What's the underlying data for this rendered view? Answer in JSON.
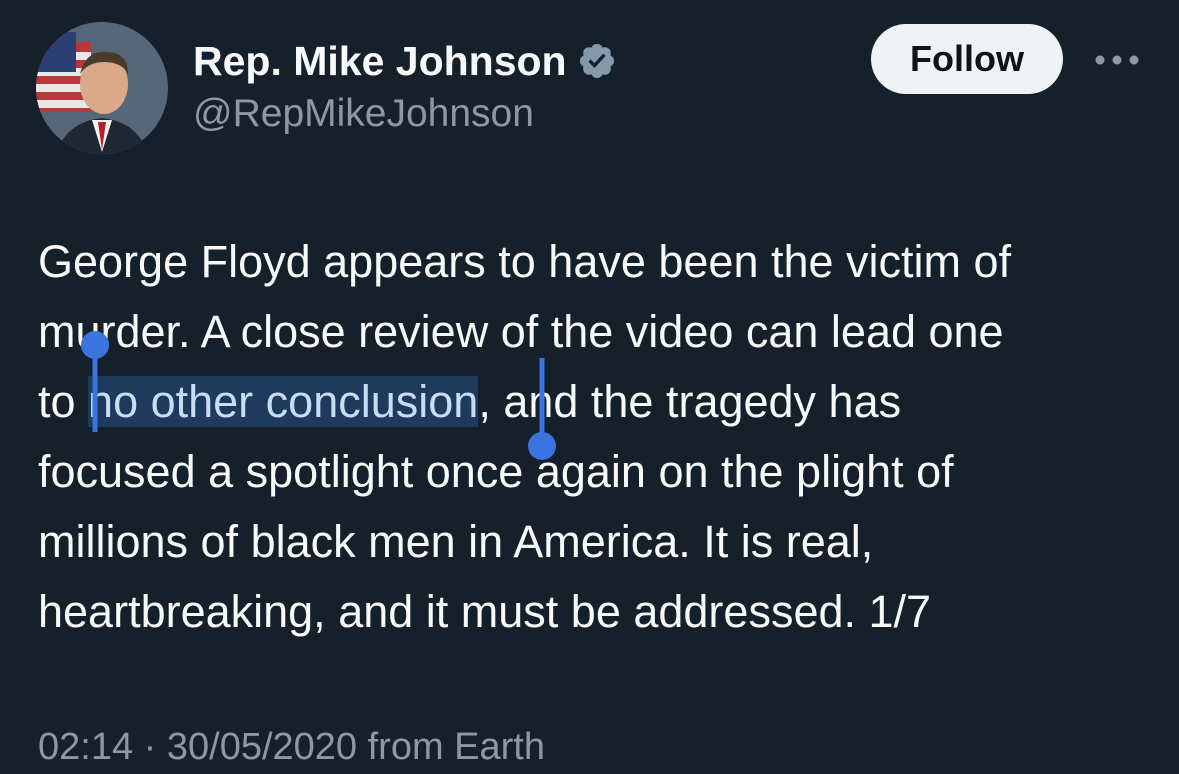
{
  "author": {
    "display_name": "Rep. Mike Johnson",
    "handle": "@RepMikeJohnson",
    "verified": true
  },
  "actions": {
    "follow_label": "Follow",
    "more_icon": "more-horizontal-icon"
  },
  "tweet": {
    "lines": [
      "George Floyd appears to have been the victim of",
      "murder. A close review of the video can lead one",
      "to ",
      ", and the tragedy has",
      "focused a spotlight once again on the plight of",
      "millions of black men in America. It is real,",
      "heartbreaking, and it must be addressed. 1/7"
    ],
    "selected_text": "no other conclusion"
  },
  "meta": {
    "timestamp": "02:14 · 30/05/2020 from Earth"
  },
  "colors": {
    "background": "#15202b",
    "text": "#f7f9f9",
    "secondary": "#8b98a5",
    "selection_handle": "#3b74e0",
    "selection_bg": "#1e3a5c"
  }
}
